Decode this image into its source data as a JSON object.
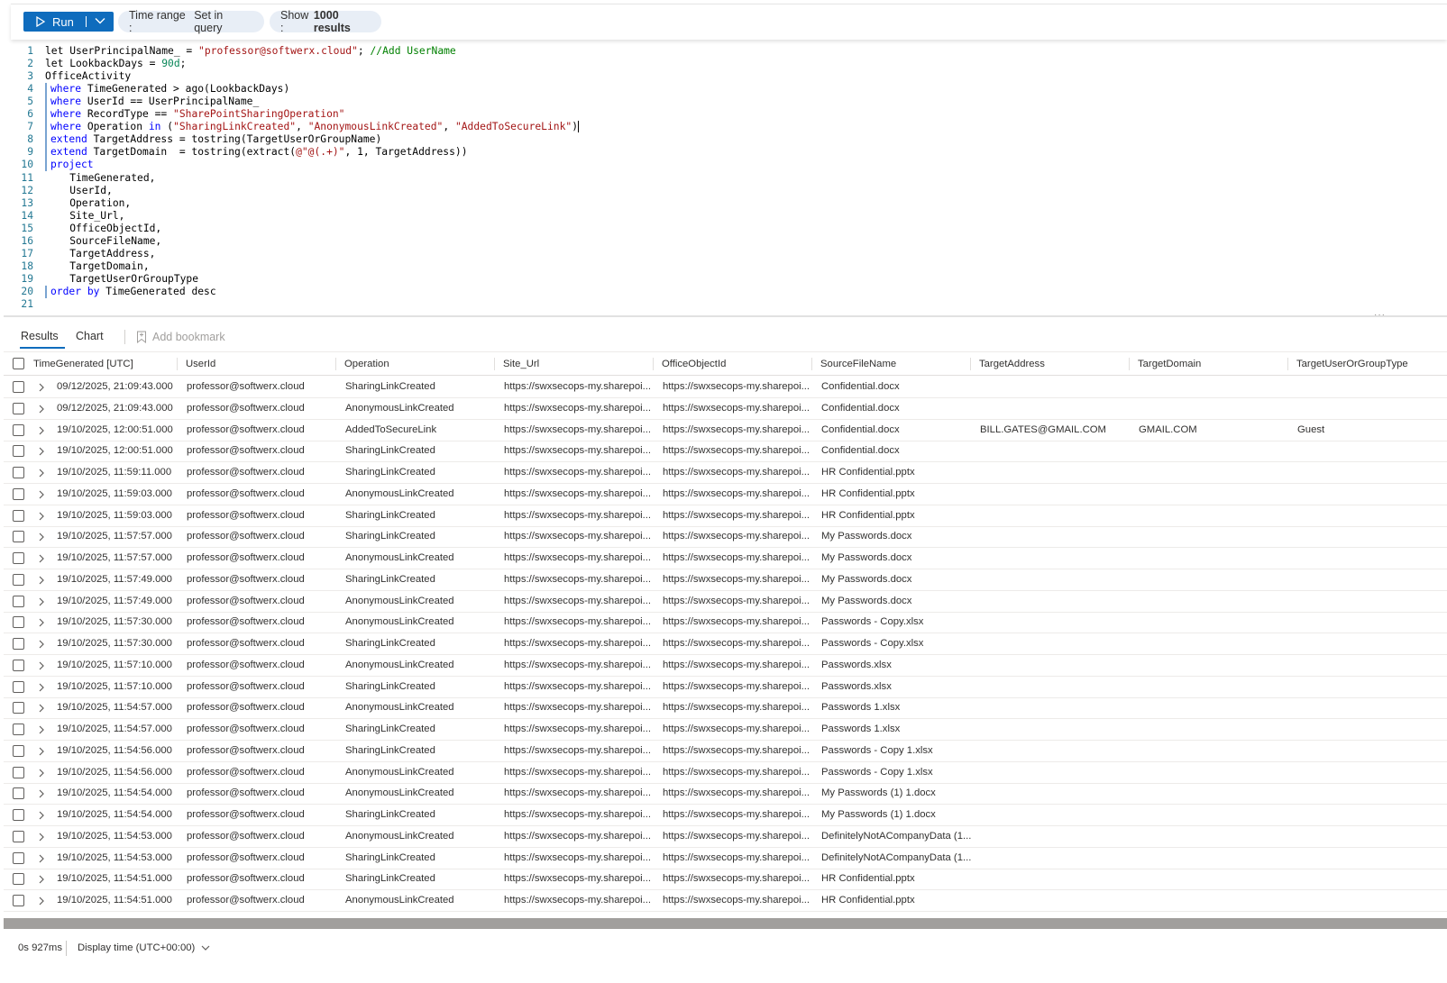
{
  "toolbar": {
    "run_label": "Run",
    "time_range_key": "Time range :",
    "time_range_value": "Set in query",
    "show_key": "Show :",
    "show_value": "1000 results"
  },
  "editor": {
    "lines": [
      {
        "n": "1",
        "segs": [
          [
            "",
            "let UserPrincipalName_ = "
          ],
          [
            "str",
            "\"professor@softwerx.cloud\""
          ],
          [
            "",
            ";"
          ],
          [
            "cmt",
            " //Add UserName"
          ]
        ]
      },
      {
        "n": "2",
        "segs": [
          [
            "",
            "let LookbackDays = "
          ],
          [
            "num",
            "90d"
          ],
          [
            "",
            ";"
          ]
        ]
      },
      {
        "n": "3",
        "segs": [
          [
            "",
            "OfficeActivity"
          ]
        ]
      },
      {
        "n": "4",
        "pipe": true,
        "segs": [
          [
            "kw",
            "where"
          ],
          [
            "",
            " TimeGenerated > ago(LookbackDays)"
          ]
        ]
      },
      {
        "n": "5",
        "pipe": true,
        "segs": [
          [
            "kw",
            "where"
          ],
          [
            "",
            " UserId == UserPrincipalName_"
          ]
        ]
      },
      {
        "n": "6",
        "pipe": true,
        "segs": [
          [
            "kw",
            "where"
          ],
          [
            "",
            " RecordType == "
          ],
          [
            "str",
            "\"SharePointSharingOperation\""
          ]
        ]
      },
      {
        "n": "7",
        "pipe": true,
        "cursor": true,
        "segs": [
          [
            "kw",
            "where"
          ],
          [
            "",
            " Operation "
          ],
          [
            "kw",
            "in"
          ],
          [
            "",
            " ("
          ],
          [
            "str",
            "\"SharingLinkCreated\""
          ],
          [
            "",
            ", "
          ],
          [
            "str",
            "\"AnonymousLinkCreated\""
          ],
          [
            "",
            ", "
          ],
          [
            "str",
            "\"AddedToSecureLink\""
          ],
          [
            "",
            ")"
          ]
        ]
      },
      {
        "n": "8",
        "pipe": true,
        "segs": [
          [
            "kw",
            "extend"
          ],
          [
            "",
            " TargetAddress = tostring(TargetUserOrGroupName)"
          ]
        ]
      },
      {
        "n": "9",
        "pipe": true,
        "segs": [
          [
            "kw",
            "extend"
          ],
          [
            "",
            " TargetDomain  = tostring(extract("
          ],
          [
            "str",
            "@\"@(.+)\""
          ],
          [
            "",
            ", 1, TargetAddress))"
          ]
        ]
      },
      {
        "n": "10",
        "pipe": true,
        "segs": [
          [
            "kw",
            "project"
          ]
        ]
      },
      {
        "n": "11",
        "segs": [
          [
            "",
            "    TimeGenerated,"
          ]
        ]
      },
      {
        "n": "12",
        "segs": [
          [
            "",
            "    UserId,"
          ]
        ]
      },
      {
        "n": "13",
        "segs": [
          [
            "",
            "    Operation,"
          ]
        ]
      },
      {
        "n": "14",
        "segs": [
          [
            "",
            "    Site_Url,"
          ]
        ]
      },
      {
        "n": "15",
        "segs": [
          [
            "",
            "    OfficeObjectId,"
          ]
        ]
      },
      {
        "n": "16",
        "segs": [
          [
            "",
            "    SourceFileName,"
          ]
        ]
      },
      {
        "n": "17",
        "segs": [
          [
            "",
            "    TargetAddress,"
          ]
        ]
      },
      {
        "n": "18",
        "segs": [
          [
            "",
            "    TargetDomain,"
          ]
        ]
      },
      {
        "n": "19",
        "segs": [
          [
            "",
            "    TargetUserOrGroupType"
          ]
        ]
      },
      {
        "n": "20",
        "pipe": true,
        "segs": [
          [
            "kw",
            "order"
          ],
          [
            "",
            " "
          ],
          [
            "kw",
            "by"
          ],
          [
            "",
            " TimeGenerated desc"
          ]
        ]
      },
      {
        "n": "21",
        "segs": [
          [
            "",
            ""
          ]
        ]
      }
    ]
  },
  "tabs": {
    "results": "Results",
    "chart": "Chart",
    "bookmark": "Add bookmark"
  },
  "grid": {
    "columns": [
      "TimeGenerated [UTC]",
      "UserId",
      "Operation",
      "Site_Url",
      "OfficeObjectId",
      "SourceFileName",
      "TargetAddress",
      "TargetDomain",
      "TargetUserOrGroupType"
    ],
    "rows": [
      [
        "09/12/2025, 21:09:43.000",
        "professor@softwerx.cloud",
        "SharingLinkCreated",
        "https://swxsecops-my.sharepoi...",
        "https://swxsecops-my.sharepoi...",
        "Confidential.docx",
        "",
        "",
        ""
      ],
      [
        "09/12/2025, 21:09:43.000",
        "professor@softwerx.cloud",
        "AnonymousLinkCreated",
        "https://swxsecops-my.sharepoi...",
        "https://swxsecops-my.sharepoi...",
        "Confidential.docx",
        "",
        "",
        ""
      ],
      [
        "19/10/2025, 12:00:51.000",
        "professor@softwerx.cloud",
        "AddedToSecureLink",
        "https://swxsecops-my.sharepoi...",
        "https://swxsecops-my.sharepoi...",
        "Confidential.docx",
        "BILL.GATES@GMAIL.COM",
        "GMAIL.COM",
        "Guest"
      ],
      [
        "19/10/2025, 12:00:51.000",
        "professor@softwerx.cloud",
        "SharingLinkCreated",
        "https://swxsecops-my.sharepoi...",
        "https://swxsecops-my.sharepoi...",
        "Confidential.docx",
        "",
        "",
        ""
      ],
      [
        "19/10/2025, 11:59:11.000",
        "professor@softwerx.cloud",
        "SharingLinkCreated",
        "https://swxsecops-my.sharepoi...",
        "https://swxsecops-my.sharepoi...",
        "HR Confidential.pptx",
        "",
        "",
        ""
      ],
      [
        "19/10/2025, 11:59:03.000",
        "professor@softwerx.cloud",
        "AnonymousLinkCreated",
        "https://swxsecops-my.sharepoi...",
        "https://swxsecops-my.sharepoi...",
        "HR Confidential.pptx",
        "",
        "",
        ""
      ],
      [
        "19/10/2025, 11:59:03.000",
        "professor@softwerx.cloud",
        "SharingLinkCreated",
        "https://swxsecops-my.sharepoi...",
        "https://swxsecops-my.sharepoi...",
        "HR Confidential.pptx",
        "",
        "",
        ""
      ],
      [
        "19/10/2025, 11:57:57.000",
        "professor@softwerx.cloud",
        "SharingLinkCreated",
        "https://swxsecops-my.sharepoi...",
        "https://swxsecops-my.sharepoi...",
        "My Passwords.docx",
        "",
        "",
        ""
      ],
      [
        "19/10/2025, 11:57:57.000",
        "professor@softwerx.cloud",
        "AnonymousLinkCreated",
        "https://swxsecops-my.sharepoi...",
        "https://swxsecops-my.sharepoi...",
        "My Passwords.docx",
        "",
        "",
        ""
      ],
      [
        "19/10/2025, 11:57:49.000",
        "professor@softwerx.cloud",
        "SharingLinkCreated",
        "https://swxsecops-my.sharepoi...",
        "https://swxsecops-my.sharepoi...",
        "My Passwords.docx",
        "",
        "",
        ""
      ],
      [
        "19/10/2025, 11:57:49.000",
        "professor@softwerx.cloud",
        "AnonymousLinkCreated",
        "https://swxsecops-my.sharepoi...",
        "https://swxsecops-my.sharepoi...",
        "My Passwords.docx",
        "",
        "",
        ""
      ],
      [
        "19/10/2025, 11:57:30.000",
        "professor@softwerx.cloud",
        "AnonymousLinkCreated",
        "https://swxsecops-my.sharepoi...",
        "https://swxsecops-my.sharepoi...",
        "Passwords - Copy.xlsx",
        "",
        "",
        ""
      ],
      [
        "19/10/2025, 11:57:30.000",
        "professor@softwerx.cloud",
        "SharingLinkCreated",
        "https://swxsecops-my.sharepoi...",
        "https://swxsecops-my.sharepoi...",
        "Passwords - Copy.xlsx",
        "",
        "",
        ""
      ],
      [
        "19/10/2025, 11:57:10.000",
        "professor@softwerx.cloud",
        "AnonymousLinkCreated",
        "https://swxsecops-my.sharepoi...",
        "https://swxsecops-my.sharepoi...",
        "Passwords.xlsx",
        "",
        "",
        ""
      ],
      [
        "19/10/2025, 11:57:10.000",
        "professor@softwerx.cloud",
        "SharingLinkCreated",
        "https://swxsecops-my.sharepoi...",
        "https://swxsecops-my.sharepoi...",
        "Passwords.xlsx",
        "",
        "",
        ""
      ],
      [
        "19/10/2025, 11:54:57.000",
        "professor@softwerx.cloud",
        "AnonymousLinkCreated",
        "https://swxsecops-my.sharepoi...",
        "https://swxsecops-my.sharepoi...",
        "Passwords 1.xlsx",
        "",
        "",
        ""
      ],
      [
        "19/10/2025, 11:54:57.000",
        "professor@softwerx.cloud",
        "SharingLinkCreated",
        "https://swxsecops-my.sharepoi...",
        "https://swxsecops-my.sharepoi...",
        "Passwords 1.xlsx",
        "",
        "",
        ""
      ],
      [
        "19/10/2025, 11:54:56.000",
        "professor@softwerx.cloud",
        "SharingLinkCreated",
        "https://swxsecops-my.sharepoi...",
        "https://swxsecops-my.sharepoi...",
        "Passwords - Copy 1.xlsx",
        "",
        "",
        ""
      ],
      [
        "19/10/2025, 11:54:56.000",
        "professor@softwerx.cloud",
        "AnonymousLinkCreated",
        "https://swxsecops-my.sharepoi...",
        "https://swxsecops-my.sharepoi...",
        "Passwords - Copy 1.xlsx",
        "",
        "",
        ""
      ],
      [
        "19/10/2025, 11:54:54.000",
        "professor@softwerx.cloud",
        "AnonymousLinkCreated",
        "https://swxsecops-my.sharepoi...",
        "https://swxsecops-my.sharepoi...",
        "My Passwords (1) 1.docx",
        "",
        "",
        ""
      ],
      [
        "19/10/2025, 11:54:54.000",
        "professor@softwerx.cloud",
        "SharingLinkCreated",
        "https://swxsecops-my.sharepoi...",
        "https://swxsecops-my.sharepoi...",
        "My Passwords (1) 1.docx",
        "",
        "",
        ""
      ],
      [
        "19/10/2025, 11:54:53.000",
        "professor@softwerx.cloud",
        "AnonymousLinkCreated",
        "https://swxsecops-my.sharepoi...",
        "https://swxsecops-my.sharepoi...",
        "DefinitelyNotACompanyData (1...",
        "",
        "",
        ""
      ],
      [
        "19/10/2025, 11:54:53.000",
        "professor@softwerx.cloud",
        "SharingLinkCreated",
        "https://swxsecops-my.sharepoi...",
        "https://swxsecops-my.sharepoi...",
        "DefinitelyNotACompanyData (1...",
        "",
        "",
        ""
      ],
      [
        "19/10/2025, 11:54:51.000",
        "professor@softwerx.cloud",
        "SharingLinkCreated",
        "https://swxsecops-my.sharepoi...",
        "https://swxsecops-my.sharepoi...",
        "HR Confidential.pptx",
        "",
        "",
        ""
      ],
      [
        "19/10/2025, 11:54:51.000",
        "professor@softwerx.cloud",
        "AnonymousLinkCreated",
        "https://swxsecops-my.sharepoi...",
        "https://swxsecops-my.sharepoi...",
        "HR Confidential.pptx",
        "",
        "",
        ""
      ]
    ]
  },
  "status": {
    "elapsed": "0s 927ms",
    "display_time": "Display time (UTC+00:00)"
  },
  "colors": {
    "accent": "#0f6cbd",
    "keyword": "#0000ff",
    "string": "#a31515",
    "number": "#098658",
    "comment": "#008000"
  },
  "icons": [
    "play-icon",
    "chevron-down-icon",
    "bookmark-icon",
    "chevron-right-icon",
    "checkbox-icon"
  ]
}
